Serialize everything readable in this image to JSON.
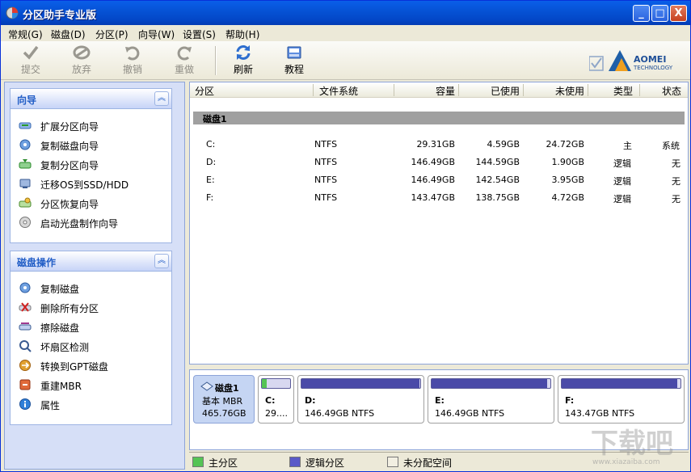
{
  "window": {
    "title": "分区助手专业版",
    "minimize": "_",
    "maximize": "□",
    "close": "X"
  },
  "menu": [
    "常规(G)",
    "磁盘(D)",
    "分区(P)",
    "向导(W)",
    "设置(S)",
    "帮助(H)"
  ],
  "toolbar": {
    "submit": "提交",
    "discard": "放弃",
    "undo": "撤销",
    "redo": "重做",
    "refresh": "刷新",
    "tutorial": "教程"
  },
  "logo": {
    "brand": "AOMEI",
    "sub": "TECHNOLOGY"
  },
  "wizard_panel": {
    "title": "向导",
    "items": [
      "扩展分区向导",
      "复制磁盘向导",
      "复制分区向导",
      "迁移OS到SSD/HDD",
      "分区恢复向导",
      "启动光盘制作向导"
    ]
  },
  "disk_ops_panel": {
    "title": "磁盘操作",
    "items": [
      "复制磁盘",
      "删除所有分区",
      "擦除磁盘",
      "坏扇区检测",
      "转换到GPT磁盘",
      "重建MBR",
      "属性"
    ]
  },
  "table": {
    "columns": [
      "分区",
      "文件系统",
      "容量",
      "已使用",
      "未使用",
      "类型",
      "状态"
    ],
    "disk_label": "磁盘1",
    "rows": [
      {
        "partition": "C:",
        "fs": "NTFS",
        "capacity": "29.31GB",
        "used": "4.59GB",
        "free": "24.72GB",
        "type": "主",
        "status": "系统"
      },
      {
        "partition": "D:",
        "fs": "NTFS",
        "capacity": "146.49GB",
        "used": "144.59GB",
        "free": "1.90GB",
        "type": "逻辑",
        "status": "无"
      },
      {
        "partition": "E:",
        "fs": "NTFS",
        "capacity": "146.49GB",
        "used": "142.54GB",
        "free": "3.95GB",
        "type": "逻辑",
        "status": "无"
      },
      {
        "partition": "F:",
        "fs": "NTFS",
        "capacity": "143.47GB",
        "used": "138.75GB",
        "free": "4.72GB",
        "type": "逻辑",
        "status": "无"
      }
    ]
  },
  "disk_map": {
    "disk": {
      "name": "磁盘1",
      "type": "基本 MBR",
      "size": "465.76GB"
    },
    "partitions": [
      {
        "name": "C:",
        "info": "29....",
        "color": "#55c455",
        "used_fraction": 0.16
      },
      {
        "name": "D:",
        "info": "146.49GB NTFS",
        "color": "#4a4aa8",
        "used_fraction": 0.99
      },
      {
        "name": "E:",
        "info": "146.49GB NTFS",
        "color": "#4a4aa8",
        "used_fraction": 0.97
      },
      {
        "name": "F:",
        "info": "143.47GB NTFS",
        "color": "#4a4aa8",
        "used_fraction": 0.97
      }
    ]
  },
  "legend": [
    {
      "label": "主分区",
      "color": "#55c455"
    },
    {
      "label": "逻辑分区",
      "color": "#5a5ac8"
    },
    {
      "label": "未分配空间",
      "color": "#f2efe2"
    }
  ],
  "watermark": {
    "text": "下载吧",
    "url": "www.xiazaiba.com"
  }
}
